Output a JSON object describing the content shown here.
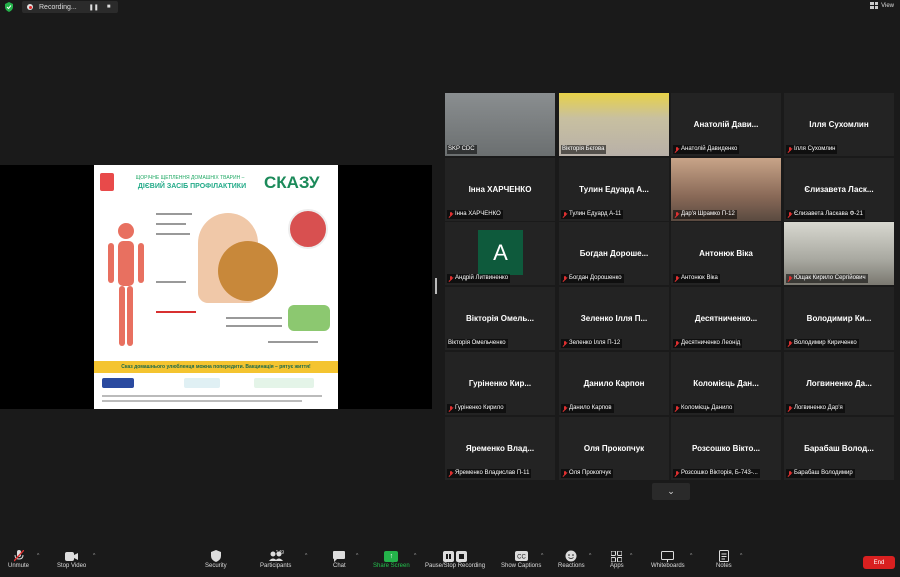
{
  "topbar": {
    "recording_label": "Recording...",
    "pause_glyph": "❚❚",
    "stop_glyph": "■",
    "view_label": "View"
  },
  "share": {
    "source_label": "",
    "poster": {
      "subtitle": "ЩОРІЧНЕ ЩЕПЛЕННЯ ДОМАШНІХ ТВАРИН –",
      "subtitle2": "ДІЄВИЙ ЗАСІБ ПРОФІЛАКТИКИ",
      "title": "СКАЗУ",
      "band": "Сказ домашнього улюбленця можна попередити. Вакцинація – рятує життя!",
      "accent": "#1c8a5a",
      "band_color": "#f4c430"
    }
  },
  "participants": [
    {
      "tile_name": "",
      "label": "SKP CDC",
      "type": "video",
      "active": true,
      "muted": false
    },
    {
      "tile_name": "",
      "label": "Вікторія Бєгова",
      "type": "video",
      "active": false,
      "muted": false
    },
    {
      "tile_name": "Анатолій Дави...",
      "label": "Анатолій Давиденко",
      "type": "name",
      "muted": true
    },
    {
      "tile_name": "Ілля Сухомлин",
      "label": "Ілля Сухомлин",
      "type": "name",
      "muted": true
    },
    {
      "tile_name": "Інна ХАРЧЕНКО",
      "label": "Інна ХАРЧЕНКО",
      "type": "name",
      "muted": true
    },
    {
      "tile_name": "Тулин Едуард А...",
      "label": "Тулин Едуард А-11",
      "type": "name",
      "muted": true
    },
    {
      "tile_name": "",
      "label": "Дар'я Шрамко П-12",
      "type": "video",
      "muted": true
    },
    {
      "tile_name": "Єлизавета Ласк...",
      "label": "Єлизавета Ласкава Ф-21",
      "type": "name",
      "muted": true
    },
    {
      "tile_name": "A",
      "label": "Андрій Литвиненко",
      "type": "avatar",
      "muted": true
    },
    {
      "tile_name": "Богдан Дороше...",
      "label": "Богдан Дорошенко",
      "type": "name",
      "muted": true
    },
    {
      "tile_name": "Антонюк Віка",
      "label": "Антонюк Віка",
      "type": "name",
      "muted": true
    },
    {
      "tile_name": "",
      "label": "Ющак Кирило Сергійович",
      "type": "video",
      "muted": true
    },
    {
      "tile_name": "Вікторія Омель...",
      "label": "Вікторія Омельченко",
      "type": "name",
      "muted": false
    },
    {
      "tile_name": "Зеленко Ілля П...",
      "label": "Зеленко Ілля П-12",
      "type": "name",
      "muted": true
    },
    {
      "tile_name": "Десятниченко...",
      "label": "Десятниченко Леонід",
      "type": "name",
      "muted": true
    },
    {
      "tile_name": "Володимир Ки...",
      "label": "Володимир Кириченко",
      "type": "name",
      "muted": true
    },
    {
      "tile_name": "Гуріненко Кир...",
      "label": "Гуріненко Кирило",
      "type": "name",
      "muted": true
    },
    {
      "tile_name": "Данило Карпон",
      "label": "Данило Карпов",
      "type": "name",
      "muted": true
    },
    {
      "tile_name": "Коломієць Дан...",
      "label": "Коломієць Данило",
      "type": "name",
      "muted": true
    },
    {
      "tile_name": "Логвиненко Да...",
      "label": "Логвиненко Дар'я",
      "type": "name",
      "muted": true
    },
    {
      "tile_name": "Яременко Влад...",
      "label": "Яременко Владислав П-11",
      "type": "name",
      "muted": true
    },
    {
      "tile_name": "Оля Прокопчук",
      "label": "Оля Прокопчук",
      "type": "name",
      "muted": true
    },
    {
      "tile_name": "Розсошко Вікто...",
      "label": "Розсошко Вікторія, Б-743-...",
      "type": "name",
      "muted": true
    },
    {
      "tile_name": "Барабаш Волод...",
      "label": "Барабаш Володимир",
      "type": "name",
      "muted": true
    }
  ],
  "grid_expand_glyph": "⌄",
  "toolbar": {
    "unmute": "Unmute",
    "stop_video": "Stop Video",
    "security": "Security",
    "participants": "Participants",
    "participants_count": "149",
    "chat": "Chat",
    "share_screen": "Share Screen",
    "record": "Pause/Stop Recording",
    "captions": "Show Captions",
    "reactions": "Reactions",
    "apps": "Apps",
    "whiteboards": "Whiteboards",
    "notes": "Notes",
    "end": "End"
  }
}
